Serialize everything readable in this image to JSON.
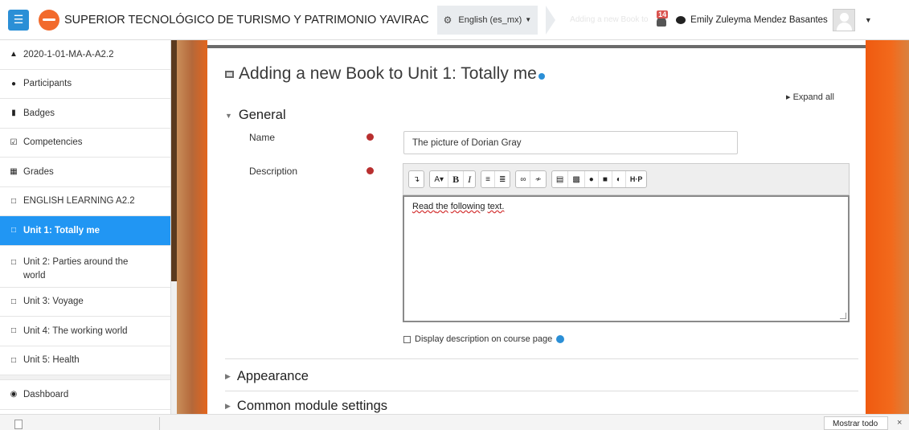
{
  "navbar": {
    "menu_icon": "hamburger-icon",
    "site_title": "SUPERIOR TECNOLÓGICO DE TURISMO Y PATRIMONIO YAVIRAC",
    "language": "English (es_mx)",
    "breadcrumb_ghost": "Adding a new Book to Unit",
    "notification_count": "14",
    "user_name": "Emily Zuleyma Mendez Basantes"
  },
  "sidebar": {
    "items": [
      {
        "label": "2020-1-01-MA-A-A2.2",
        "icon": "graduation-cap-icon"
      },
      {
        "label": "Participants",
        "icon": "users-icon"
      },
      {
        "label": "Badges",
        "icon": "shield-icon"
      },
      {
        "label": "Competencies",
        "icon": "check-square-icon"
      },
      {
        "label": "Grades",
        "icon": "table-icon"
      },
      {
        "label": "ENGLISH LEARNING A2.2",
        "icon": "folder-icon"
      },
      {
        "label": "Unit 1: Totally me",
        "icon": "folder-icon"
      },
      {
        "label": "Unit 2: Parties around the world",
        "icon": "folder-icon"
      },
      {
        "label": "Unit 3: Voyage",
        "icon": "folder-icon"
      },
      {
        "label": "Unit 4: The working world",
        "icon": "folder-icon"
      },
      {
        "label": "Unit 5: Health",
        "icon": "folder-icon"
      },
      {
        "label": "Dashboard",
        "icon": "tachometer-icon"
      }
    ]
  },
  "main": {
    "heading": "Adding a new Book to Unit 1: Totally me",
    "expand_all": "Expand all",
    "general_section": "General",
    "name_label": "Name",
    "name_value": "The picture of Dorian Gray",
    "description_label": "Description",
    "editor_text_1": "Read ",
    "editor_text_2": "the",
    "editor_text_3": " ",
    "editor_text_4": "following",
    "editor_text_5": " ",
    "editor_text_6": "text.",
    "display_description": "Display description on course page",
    "appearance_section": "Appearance",
    "common_section": "Common module settings"
  },
  "bottombar": {
    "show_all": "Mostrar todo",
    "close": "×"
  }
}
